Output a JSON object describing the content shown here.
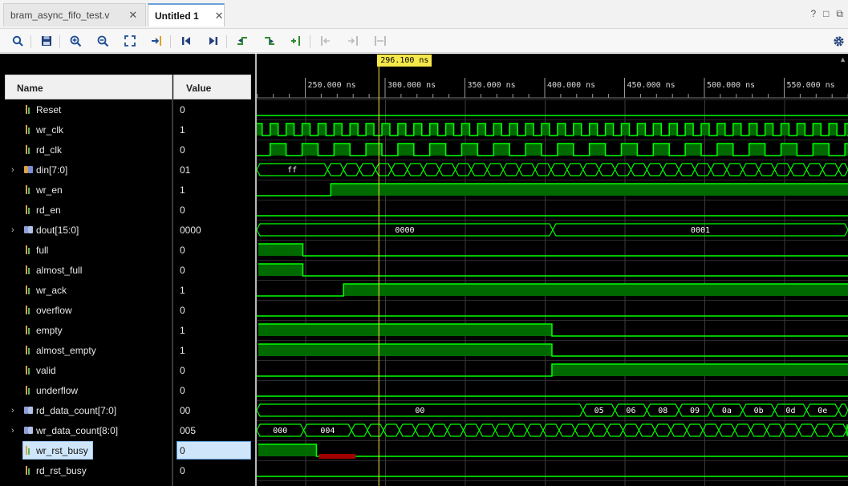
{
  "tabs": [
    {
      "label": "bram_async_fifo_test.v",
      "active": false
    },
    {
      "label": "Untitled 1",
      "active": true
    }
  ],
  "window_controls": [
    "?",
    "□",
    "⧉"
  ],
  "toolbar": {
    "icons": [
      "search-icon",
      "save-icon",
      "zoom-in-icon",
      "zoom-out-icon",
      "zoom-fit-icon",
      "go-to-cursor-icon",
      "go-to-start-icon",
      "go-to-end-icon",
      "previous-transition-icon",
      "next-transition-icon",
      "add-marker-icon",
      "previous-marker-icon",
      "next-marker-icon",
      "swap-cursors-icon",
      "settings-icon"
    ]
  },
  "columns": {
    "name": "Name",
    "value": "Value"
  },
  "cursor": {
    "label": "296.100 ns",
    "time_ns": 296.1,
    "color": "#f5e84b"
  },
  "timeline": {
    "ticks": [
      "250.000 ns",
      "300.000 ns",
      "350.000 ns",
      "400.000 ns",
      "450.000 ns",
      "500.000 ns",
      "550.000 ns"
    ]
  },
  "colors": {
    "wave": "#00ff00",
    "fill": "#006a00",
    "error": "#a00000",
    "selected_bg": "#cfe6fa"
  },
  "signals": [
    {
      "name": "Reset",
      "value": "0",
      "kind": "bit",
      "expandable": false
    },
    {
      "name": "wr_clk",
      "value": "1",
      "kind": "bit",
      "expandable": false
    },
    {
      "name": "rd_clk",
      "value": "0",
      "kind": "bit",
      "expandable": false
    },
    {
      "name": "din[7:0]",
      "value": "01",
      "kind": "bus",
      "expandable": true,
      "bus_labels": [
        "ff"
      ]
    },
    {
      "name": "wr_en",
      "value": "1",
      "kind": "bit",
      "expandable": false
    },
    {
      "name": "rd_en",
      "value": "0",
      "kind": "bit",
      "expandable": false
    },
    {
      "name": "dout[15:0]",
      "value": "0000",
      "kind": "busout",
      "expandable": true,
      "bus_labels": [
        "0000",
        "0001"
      ]
    },
    {
      "name": "full",
      "value": "0",
      "kind": "out",
      "expandable": false
    },
    {
      "name": "almost_full",
      "value": "0",
      "kind": "out",
      "expandable": false
    },
    {
      "name": "wr_ack",
      "value": "1",
      "kind": "out",
      "expandable": false
    },
    {
      "name": "overflow",
      "value": "0",
      "kind": "out",
      "expandable": false
    },
    {
      "name": "empty",
      "value": "1",
      "kind": "out",
      "expandable": false
    },
    {
      "name": "almost_empty",
      "value": "1",
      "kind": "out",
      "expandable": false
    },
    {
      "name": "valid",
      "value": "0",
      "kind": "out",
      "expandable": false
    },
    {
      "name": "underflow",
      "value": "0",
      "kind": "out",
      "expandable": false
    },
    {
      "name": "rd_data_count[7:0]",
      "value": "00",
      "kind": "busout",
      "expandable": true,
      "bus_labels": [
        "00",
        "05",
        "06",
        "08",
        "09",
        "0a",
        "0b",
        "0d",
        "0e"
      ]
    },
    {
      "name": "wr_data_count[8:0]",
      "value": "005",
      "kind": "busout",
      "expandable": true,
      "bus_labels": [
        "000",
        "004"
      ]
    },
    {
      "name": "wr_rst_busy",
      "value": "0",
      "kind": "out",
      "expandable": false,
      "selected": true
    },
    {
      "name": "rd_rst_busy",
      "value": "0",
      "kind": "out",
      "expandable": false
    }
  ]
}
